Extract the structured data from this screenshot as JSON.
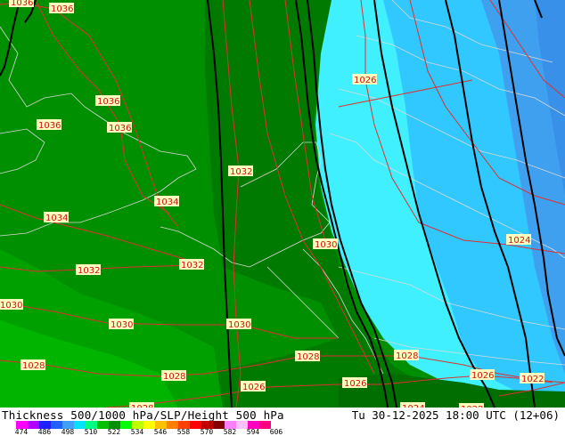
{
  "map": {
    "isobar_labels": [
      "1036",
      "1036",
      "1036",
      "1036",
      "1036",
      "1032",
      "1034",
      "1034",
      "1032",
      "1032",
      "1030",
      "1030",
      "1030",
      "1030",
      "1028",
      "1028",
      "1028",
      "1028",
      "1026",
      "1026",
      "1026",
      "1026",
      "1024",
      "1024",
      "1022",
      "1028",
      "1022"
    ],
    "colors": {
      "thickness_552_558": "#008f00",
      "thickness_546_552": "#007a00",
      "thickness_558_564": "#00a800",
      "cyan_522_528": "#40f0ff",
      "blue_516_522": "#30c8ff",
      "blue_510_516": "#40a0f0",
      "isobar_line": "#e03030",
      "height_line": "#000000",
      "coast_line": "#d0d0d0"
    }
  },
  "footer": {
    "title": "Thickness 500/1000 hPa/SLP/Height 500 hPa",
    "valid_time": "Tu 30-12-2025 18:00 UTC (12+06)",
    "colorbar": {
      "colors": [
        "#ff00ff",
        "#b000ff",
        "#2020ff",
        "#2060ff",
        "#40a0ff",
        "#00e0ff",
        "#00ff80",
        "#00c000",
        "#009000",
        "#00ff00",
        "#c0ff00",
        "#ffff00",
        "#ffc000",
        "#ff8000",
        "#ff4000",
        "#ff0000",
        "#c00000",
        "#800000",
        "#ff80ff",
        "#ffc0ff",
        "#ff00c0",
        "#ff0080"
      ],
      "tick_labels": [
        "474",
        "486",
        "498",
        "510",
        "522",
        "534",
        "546",
        "558",
        "570",
        "582",
        "594",
        "606"
      ]
    }
  }
}
